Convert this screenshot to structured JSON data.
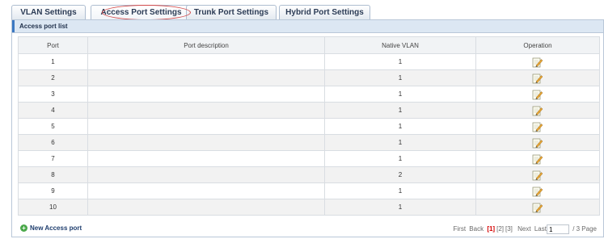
{
  "tabs": [
    {
      "label": "VLAN Settings"
    },
    {
      "label": "Access Port Settings"
    },
    {
      "label": "Trunk Port Settings"
    },
    {
      "label": "Hybrid Port Settings"
    }
  ],
  "panel": {
    "title": "Access port list"
  },
  "table": {
    "headers": [
      "Port",
      "Port description",
      "Native VLAN",
      "Operation"
    ],
    "rows": [
      {
        "port": "1",
        "description": "",
        "native_vlan": "1"
      },
      {
        "port": "2",
        "description": "",
        "native_vlan": "1"
      },
      {
        "port": "3",
        "description": "",
        "native_vlan": "1"
      },
      {
        "port": "4",
        "description": "",
        "native_vlan": "1"
      },
      {
        "port": "5",
        "description": "",
        "native_vlan": "1"
      },
      {
        "port": "6",
        "description": "",
        "native_vlan": "1"
      },
      {
        "port": "7",
        "description": "",
        "native_vlan": "1"
      },
      {
        "port": "8",
        "description": "",
        "native_vlan": "2"
      },
      {
        "port": "9",
        "description": "",
        "native_vlan": "1"
      },
      {
        "port": "10",
        "description": "",
        "native_vlan": "1"
      }
    ],
    "operation_icon": "edit-icon"
  },
  "footer": {
    "new_label": "New Access port",
    "pager": {
      "first": "First",
      "back": "Back",
      "pages": [
        "[1]",
        "[2]",
        "[3]"
      ],
      "current_page": "[1]",
      "next": "Next",
      "last": "Last",
      "input_value": "1",
      "total": "/ 3 Page"
    }
  }
}
